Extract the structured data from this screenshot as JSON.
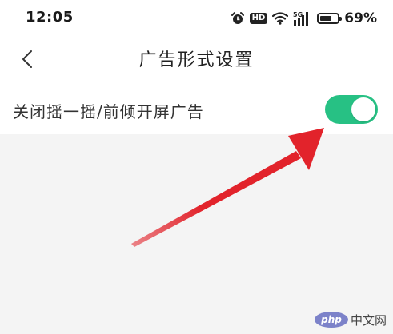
{
  "status_bar": {
    "time": "12:05",
    "hd_badge": "HD",
    "network": "5G",
    "battery_percent": "69%",
    "battery_level": 0.69,
    "icons": [
      "alarm-icon",
      "hd-icon",
      "wifi-icon",
      "signal-icon",
      "battery-icon"
    ]
  },
  "nav": {
    "back_icon": "chevron-left-icon",
    "title": "广告形式设置"
  },
  "settings": [
    {
      "label": "关闭摇一摇/前倾开屏广告",
      "enabled": true
    }
  ],
  "colors": {
    "toggle_on": "#27c184",
    "arrow": "#e2232b",
    "background": "#f4f4f4"
  },
  "watermark": {
    "logo_text": "php",
    "site_text": "中文网"
  }
}
